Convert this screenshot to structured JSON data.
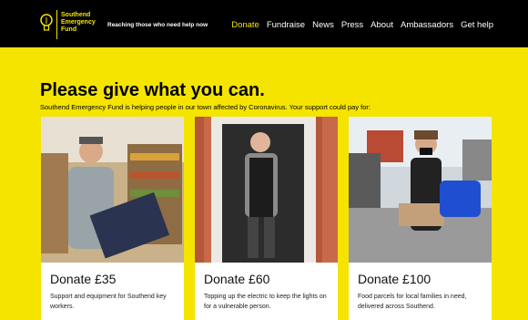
{
  "brand": {
    "line1": "Southend",
    "line2": "Emergency",
    "line3": "Fund"
  },
  "tagline": "Reaching those who need help now",
  "nav": [
    "Donate",
    "Fundraise",
    "News",
    "Press",
    "About",
    "Ambassadors",
    "Get help"
  ],
  "heading": "Please give what you can.",
  "subheading": "Southend Emergency Fund is helping people in our town affected by Coronavirus. Your support could pay for:",
  "cards": [
    {
      "title": "Donate £35",
      "desc": "Support and equipment for Southend key workers."
    },
    {
      "title": "Donate £60",
      "desc": "Topping up the electric to keep the lights on for a vulnerable person."
    },
    {
      "title": "Donate £100",
      "desc": "Food parcels for local families in need, delivered across Southend."
    }
  ],
  "colors": {
    "accent": "#f5e400",
    "header": "#000000"
  }
}
